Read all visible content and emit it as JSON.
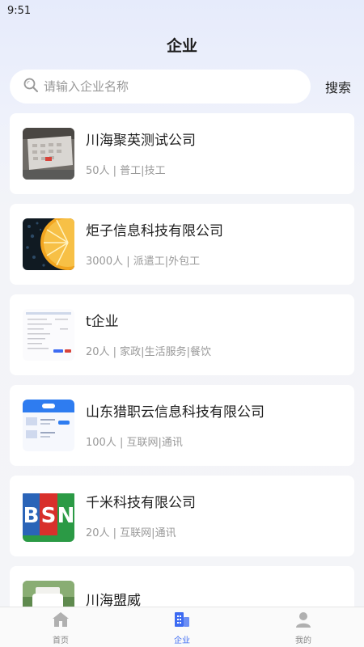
{
  "status_bar": {
    "time": "9:51"
  },
  "header": {
    "title": "企业"
  },
  "search": {
    "placeholder": "请输入企业名称",
    "button_label": "搜索"
  },
  "companies": [
    {
      "name": "川海聚英测试公司",
      "meta": "50人 | 普工|技工",
      "logo_icon": "calendar-photo"
    },
    {
      "name": "炬子信息科技有限公司",
      "meta": "3000人 | 派遣工|外包工",
      "logo_icon": "orange-slice-photo"
    },
    {
      "name": "t企业",
      "meta": "20人 | 家政|生活服务|餐饮",
      "logo_icon": "document-screenshot"
    },
    {
      "name": "山东猎职云信息科技有限公司",
      "meta": "100人 | 互联网|通讯",
      "logo_icon": "web-screenshot"
    },
    {
      "name": "千米科技有限公司",
      "meta": "20人 | 互联网|通讯",
      "logo_icon": "bsn-logo",
      "logo_letters": [
        "B",
        "S",
        "N"
      ]
    },
    {
      "name": "川海盟威",
      "meta": "",
      "logo_icon": "bottle-photo"
    }
  ],
  "tabbar": {
    "items": [
      {
        "label": "首页",
        "icon": "home-icon",
        "active": false
      },
      {
        "label": "企业",
        "icon": "company-icon",
        "active": true
      },
      {
        "label": "我的",
        "icon": "profile-icon",
        "active": false
      }
    ]
  },
  "colors": {
    "accent": "#3d6bf2",
    "inactive": "#8a8a8a",
    "muted_text": "#999999"
  }
}
